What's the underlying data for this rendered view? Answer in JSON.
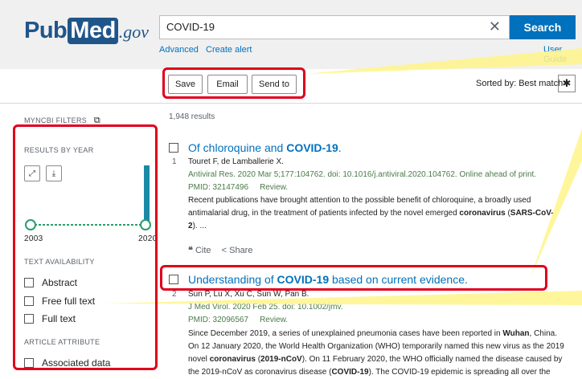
{
  "header": {
    "logo": {
      "pub": "Pub",
      "med": "Med",
      "gov": ".gov"
    },
    "search_value": "COVID-19",
    "search_button": "Search",
    "advanced": "Advanced",
    "create_alert": "Create alert",
    "user_guide": "User Guide"
  },
  "toolbar": {
    "save": "Save",
    "email": "Email",
    "send_to": "Send to",
    "sorted_by": "Sorted by: Best match"
  },
  "sidebar": {
    "myncbi": "MYNCBI FILTERS",
    "results_by_year": "RESULTS BY YEAR",
    "year_start": "2003",
    "year_end": "2020",
    "text_availability": "TEXT AVAILABILITY",
    "abstract": "Abstract",
    "free_full_text": "Free full text",
    "full_text": "Full text",
    "article_attribute": "ARTICLE ATTRIBUTE",
    "associated_data": "Associated data"
  },
  "results": {
    "count": "1,948 results",
    "items": [
      {
        "num": "1",
        "title_pre": "Of chloroquine and ",
        "title_bold": "COVID-19",
        "title_post": ".",
        "authors": "Touret F, de Lamballerie X.",
        "citation": "Antiviral Res. 2020 Mar 5;177:104762. doi: 10.1016/j.antiviral.2020.104762. Online ahead of print.",
        "pmid": "PMID: 32147496",
        "type": "Review.",
        "snippet1": "Recent publications have brought attention to the possible benefit of chloroquine, a broadly used",
        "snippet2a": "antimalarial drug, in the treatment of patients infected by the novel emerged ",
        "snippet2b": "coronavirus",
        "snippet2c": " (",
        "snippet2d": "SARS-CoV-",
        "snippet3a": "2",
        "snippet3b": "). ...",
        "cite": "Cite",
        "share": "Share"
      },
      {
        "num": "2",
        "title_pre": "Understanding of ",
        "title_bold": "COVID-19",
        "title_post": " based on current evidence.",
        "authors": "Sun P, Lu X, Xu C, Sun W, Pan B.",
        "citation": "J Med Virol. 2020 Feb 25. doi: 10.1002/jmv.",
        "pmid": "PMID: 32096567",
        "type": "Review.",
        "s1a": "Since December 2019, a series of unexplained pneumonia cases have been reported in ",
        "s1b": "Wuhan",
        "s1c": ", China.",
        "s2": "On 12 January 2020, the World Health Organization (WHO) temporarily named this new virus as the 2019",
        "s3a": "novel ",
        "s3b": "coronavirus",
        "s3c": " (",
        "s3d": "2019-nCoV",
        "s3e": "). On 11 February 2020, the WHO officially named the disease caused by",
        "s4a": "the 2019-nCoV as coronavirus disease (",
        "s4b": "COVID-19",
        "s4c": "). The COVID-19 epidemic is spreading all over the"
      }
    ]
  },
  "colors": {
    "brand": "#20558a",
    "link": "#0071bc",
    "highlight": "#e0001b",
    "callout": "#fff48a",
    "bar": "#1a8aa6",
    "slider": "#2a9d6a"
  }
}
